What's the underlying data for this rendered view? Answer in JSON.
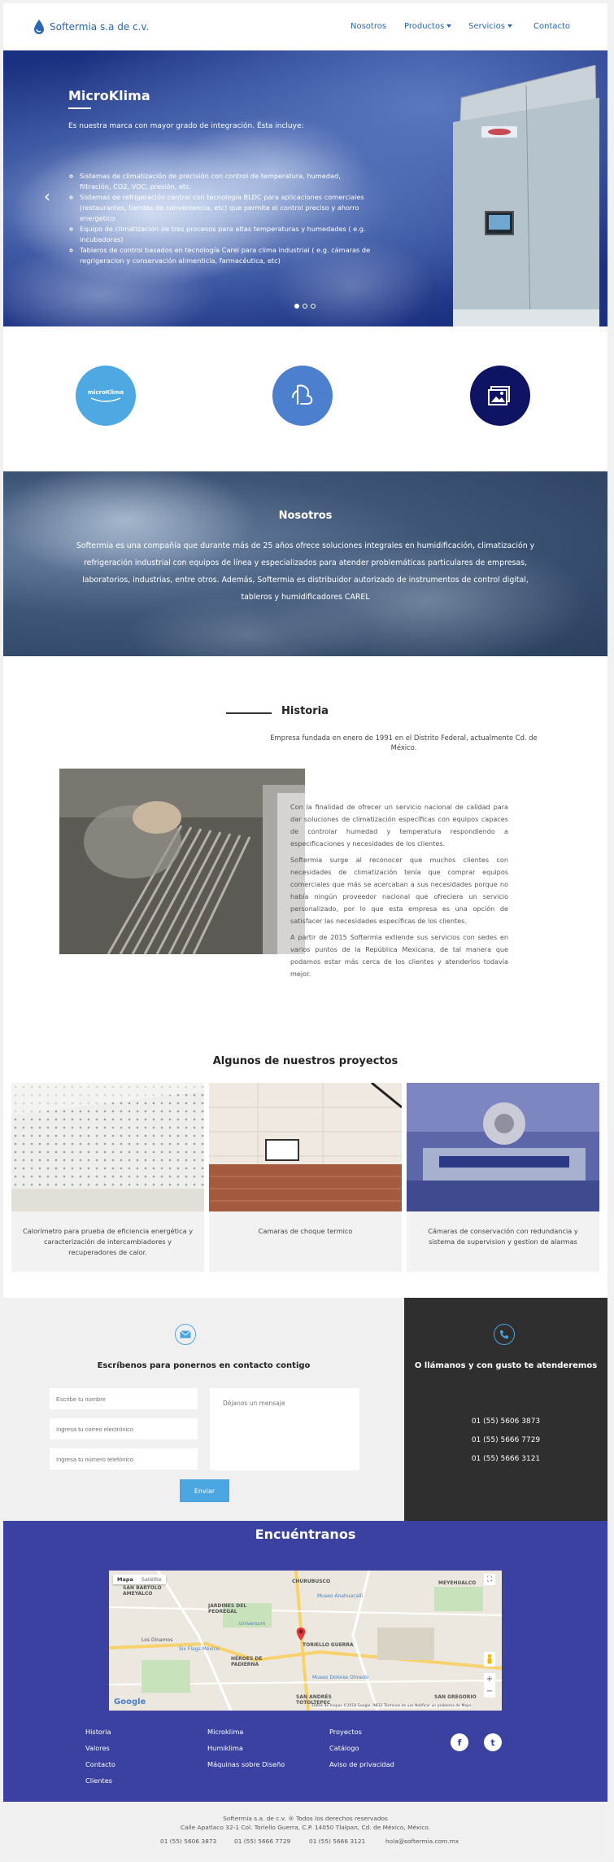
{
  "header": {
    "logo_text": "Softermia s.a de c.v.",
    "nav": [
      "Nosotros",
      "Productos",
      "Servicios",
      "Contacto"
    ]
  },
  "hero": {
    "title": "MicroKlima",
    "subtitle": "Es nuestra marca con mayor grado de integración. Ésta incluye:",
    "items": [
      "Sistemas de climatización de precisión con control de temperatura, humedad, filtración, CO2, VOC, presión, etc.",
      "Sistemas de refrigeración central con tecnología BLDC para aplicaciones comerciales (restaurantes, tiendas de conveniencia, etc) que permite el control preciso y ahorro energetico",
      "Equipo de climatización de tres procesos para altas temperaturas y humedades ( e.g. incubadoras)",
      "Tableros de control basados en tecnología Carel para clima industrial ( e.g. cámaras de regrigeracion y conservación alimenticia, farmacéutica, etc)"
    ],
    "slide_count": 3,
    "active_slide": 1
  },
  "circles": {
    "microklima_label": "microKlima"
  },
  "nosotros": {
    "title": "Nosotros",
    "text": "Softermia es una compañía que durante más de 25 años ofrece soluciones integrales en humidificación, climatización y refrigeración industrial con equipos de línea y especializados para atender problemáticas particulares de empresas, laboratorios, industrias, entre otros. Además, Softermia es distribuidor autorizado de instrumentos de control digital, tableros y humidificadores CAREL"
  },
  "historia": {
    "title": "Historia",
    "intro": "Empresa fundada en enero de 1991 en el Distrito Federal, actualmente Cd. de México.",
    "paragraphs": [
      "Con la finalidad de ofrecer un servicio nacional de calidad para dar soluciones de climatización específicas con equipos capaces de controlar humedad y temperatura respondiendo a especificaciones y necesidades de los clientes.",
      "Softermia surge al reconocer que muchos clientes con necesidades de climatización tenía que comprar equipos comerciales que más se acercaban a sus necesidades porque no había ningún proveedor nacional que ofreciera un servicio personalizado, por lo que esta empresa es una opción de satisfacer las necesidades específicas de los clientes.",
      "A partir de 2015 Softermia extiende sus servicios con sedes en varios puntos de la República Mexicana, de tal manera que podamos estar más cerca de los clientes y atenderlos todavía mejor."
    ]
  },
  "proyectos": {
    "title": "Algunos de nuestros proyectos",
    "cards": [
      {
        "caption": "Calorímetro para prueba de eficiencia energética y caracterización de intercambiadores y recuperadores de calor."
      },
      {
        "caption": "Camaras de choque termico"
      },
      {
        "caption": "Cámaras de conservación con redundancia y sistema de supervision y gestion de alarmas"
      }
    ]
  },
  "contacto": {
    "title": "Escríbenos para ponernos en contacto contigo",
    "name_placeholder": "Escribe tu nombre",
    "email_placeholder": "Ingresa tu correo electrónico",
    "phone_placeholder": "Ingresa tu número telefónico",
    "message_placeholder": "Déjanos un mensaje",
    "send_label": "Enviar",
    "call_title": "O llámanos y con gusto te atenderemos",
    "phones": [
      "01 (55) 5606 3873",
      "01 (55) 5666 7729",
      "01 (55) 5666 3121"
    ]
  },
  "encuentranos": {
    "title": "Encuéntranos",
    "map_tabs": [
      "Mapa",
      "Satélite"
    ],
    "map_labels": [
      "SAN BARTOLO AMEYALCO",
      "CHURUBUSCO",
      "MEYEHUALCO",
      "JARDINES DEL PEDREGAL",
      "Museo Anahuacalli",
      "Universum",
      "Six Flags México",
      "TORIELLO GUERRA",
      "HÉROES DE PADIERNA",
      "Museo Dolores Olmedo",
      "SAN ANDRÉS TOTOLTEPEC",
      "SAN GREGORIO",
      "Los Dinamos"
    ],
    "map_footer": "Datos de mapas ©2018 Google, INEGI   Términos de uso   Notificar un problema de Maps",
    "google": "Google"
  },
  "footer_links": {
    "col1": [
      "Historia",
      "Valores",
      "Contacto",
      "Clientes"
    ],
    "col2": [
      "Microklima",
      "Humiklima",
      "Máquinas sobre Diseño"
    ],
    "col3": [
      "Proyectos",
      "Catálogo",
      "Aviso de privacidad"
    ],
    "social": [
      "f",
      "t"
    ]
  },
  "footer": {
    "copyright": "Softermia s.a. de c.v. ® Todos los derechos reservados",
    "address": "Calle Apatlaco 32-1 Col. Toriello Guerra, C.P. 14050 Tlalpan, Cd. de México, México.",
    "phones": [
      "01 (55) 5606 3873",
      "01 (55) 5666 7729",
      "01 (55) 5666 3121"
    ],
    "email": "hola@softermia.com.mx"
  },
  "colors": {
    "brand_blue": "#2a66b1",
    "indigo": "#3a41a0",
    "accent_light_blue": "#4aa5e0",
    "dark_panel": "#2f2f2f"
  }
}
